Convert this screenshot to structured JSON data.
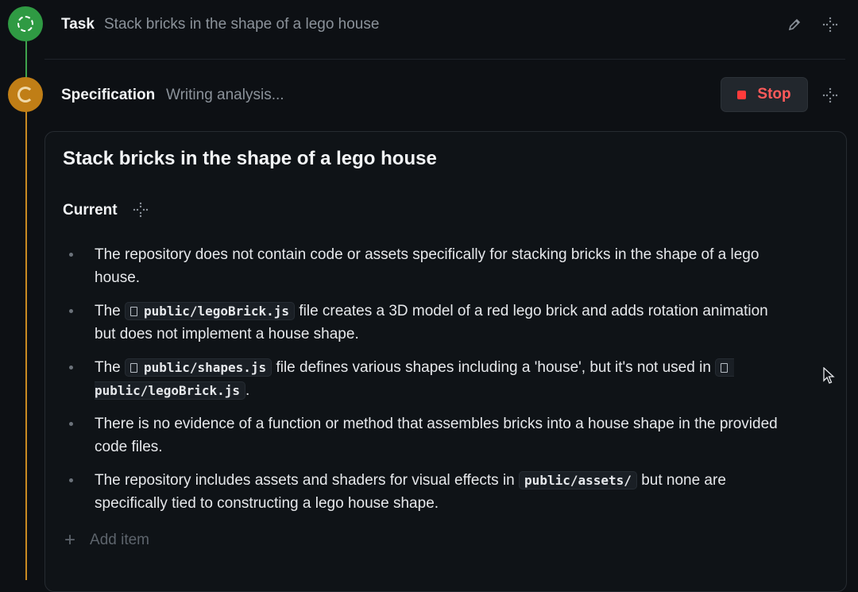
{
  "task": {
    "label": "Task",
    "description": "Stack bricks in the shape of a lego house",
    "edit_icon": "pencil-icon",
    "drag_icon": "drag-handle-icon"
  },
  "specification": {
    "label": "Specification",
    "status": "Writing analysis...",
    "stop_label": "Stop",
    "card": {
      "title": "Stack bricks in the shape of a lego house",
      "section_label": "Current",
      "items": [
        {
          "text": "The repository does not contain code or assets specifically for stacking bricks in the shape of a lego house."
        },
        {
          "pre": "The",
          "file": "public/legoBrick.js",
          "post": "file creates a 3D model of a red lego brick and adds rotation animation but does not implement a house shape."
        },
        {
          "pre": "The",
          "file": "public/shapes.js",
          "mid": "file defines various shapes including a 'house', but it's not used in",
          "file2": "public/legoBrick.js",
          "post": "."
        },
        {
          "text": "There is no evidence of a function or method that assembles bricks into a house shape in the provided code files."
        },
        {
          "pre": "The repository includes assets and shaders for visual effects in",
          "code": "public/assets/",
          "post": "but none are specifically tied to constructing a lego house shape."
        }
      ],
      "add_item_label": "Add item"
    }
  },
  "colors": {
    "done": "#2f9a43",
    "in_progress": "#c07e16",
    "stop": "#ff5a5a"
  }
}
